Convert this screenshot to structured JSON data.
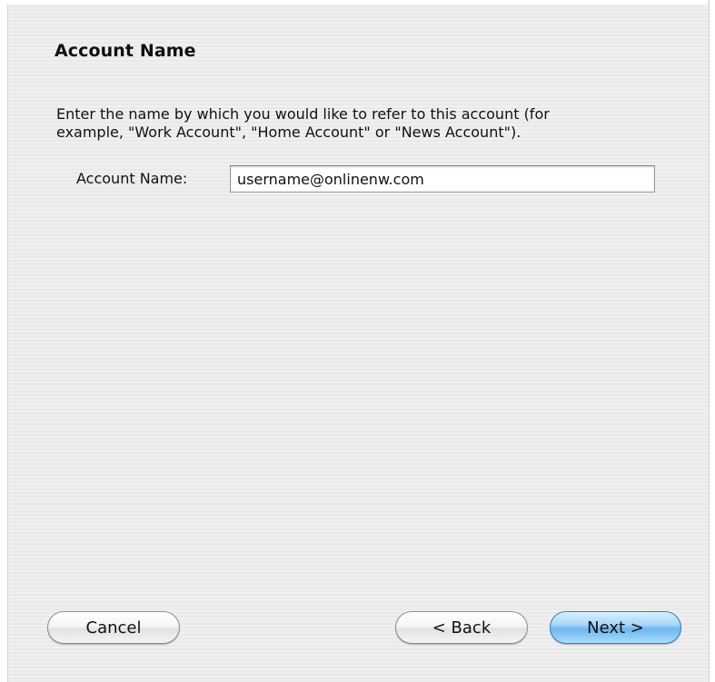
{
  "page": {
    "title": "Account Name",
    "instruction": "Enter the name by which you would like to refer to this account (for\nexample, \"Work Account\", \"Home Account\" or \"News Account\")."
  },
  "form": {
    "account_name_label": "Account Name:",
    "account_name_value": "username@onlinenw.com"
  },
  "buttons": {
    "cancel": "Cancel",
    "back": "< Back",
    "next": "Next >"
  },
  "colors": {
    "panel_background": "#eeeeee",
    "default_button_accent": "#7cbcf2"
  }
}
